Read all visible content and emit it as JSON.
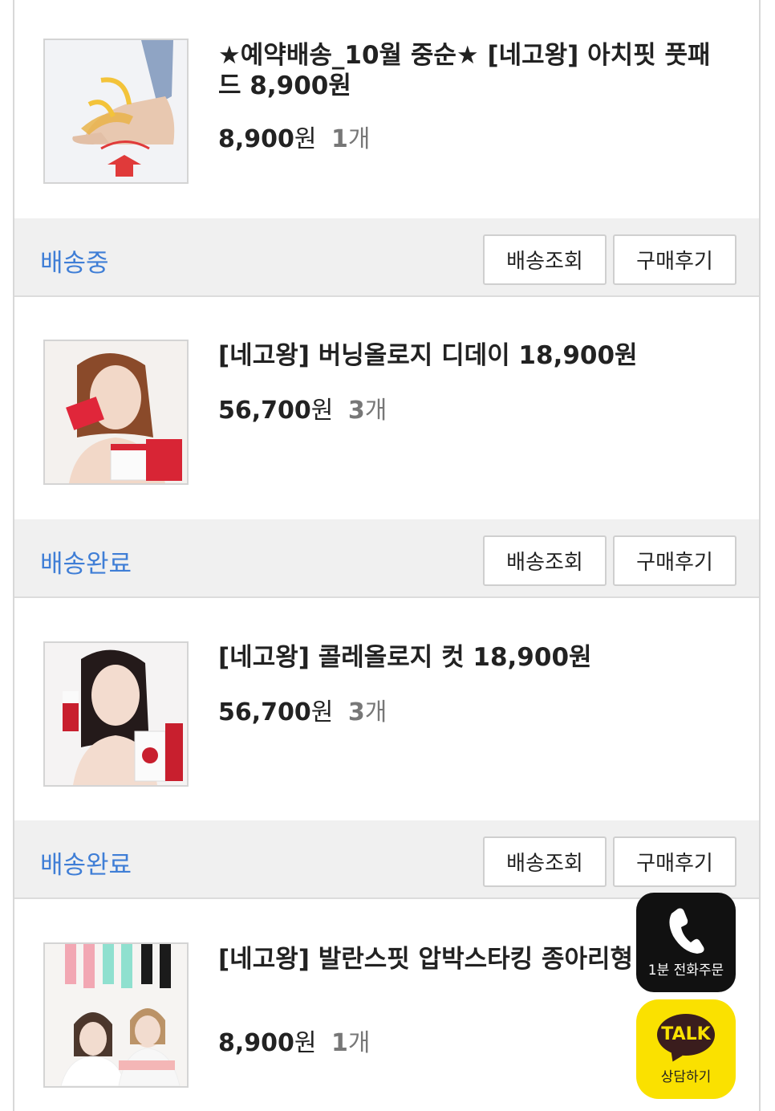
{
  "orders": [
    {
      "title": "★예약배송_10월 중순★ [네고왕] 아치핏 풋패드 8,900원",
      "price": "8,900",
      "won": "원",
      "qty": "1",
      "qty_unit": "개",
      "image": "foot-pad-product-image"
    },
    {
      "title": "[네고왕] 버닝올로지 디데이 18,900원",
      "price": "56,700",
      "won": "원",
      "qty": "3",
      "qty_unit": "개",
      "image": "burning-dday-product-image"
    },
    {
      "title": "[네고왕] 콜레올로지 컷 18,900원",
      "price": "56,700",
      "won": "원",
      "qty": "3",
      "qty_unit": "개",
      "image": "colleology-cut-product-image"
    },
    {
      "title": "[네고왕] 발란스핏 압박스타킹 종아리형 원",
      "price": "8,900",
      "won": "원",
      "qty": "1",
      "qty_unit": "개",
      "image": "compression-stocking-product-image"
    }
  ],
  "status_bars": [
    {
      "status": "배송중",
      "track_label": "배송조회",
      "review_label": "구매후기"
    },
    {
      "status": "배송완료",
      "track_label": "배송조회",
      "review_label": "구매후기"
    },
    {
      "status": "배송완료",
      "track_label": "배송조회",
      "review_label": "구매후기"
    }
  ],
  "floating": {
    "call_label": "1분 전화주문",
    "talk_badge": "TALK",
    "talk_label": "상담하기"
  },
  "colors": {
    "status_blue": "#3f7ed6",
    "kakao_yellow": "#fae100",
    "kakao_brown": "#3a1d1d"
  }
}
